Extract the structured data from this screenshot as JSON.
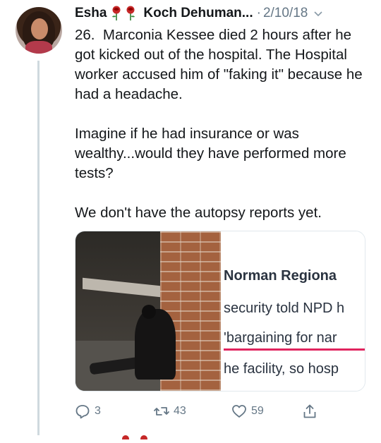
{
  "tweet": {
    "author_name_first": "Esha",
    "author_name_rest": "Koch Dehuman...",
    "separator": "·",
    "date": "2/10/18",
    "text": "26.  Marconia Kessee died 2 hours after he got kicked out of the hospital. The Hospital worker accused him of \"faking it\" because he had a headache.\n\nImagine if he had insurance or was wealthy...would they have performed more tests?\n\nWe don't have the autopsy reports yet."
  },
  "media": {
    "headline": "Norman Regiona",
    "line1": "security told NPD h",
    "line2": "'bargaining for nar",
    "line3": "he facility, so hosp"
  },
  "actions": {
    "replies": "3",
    "retweets": "43",
    "likes": "59"
  },
  "icons": {
    "rose": "rose-emoji",
    "menu": "chevron-down-icon",
    "reply": "reply-icon",
    "retweet": "retweet-icon",
    "like": "heart-icon",
    "share": "share-icon"
  },
  "colors": {
    "text": "#14171a",
    "secondary": "#657786",
    "highlight_underline": "#e0245e",
    "thread_line": "#cfd9de"
  }
}
